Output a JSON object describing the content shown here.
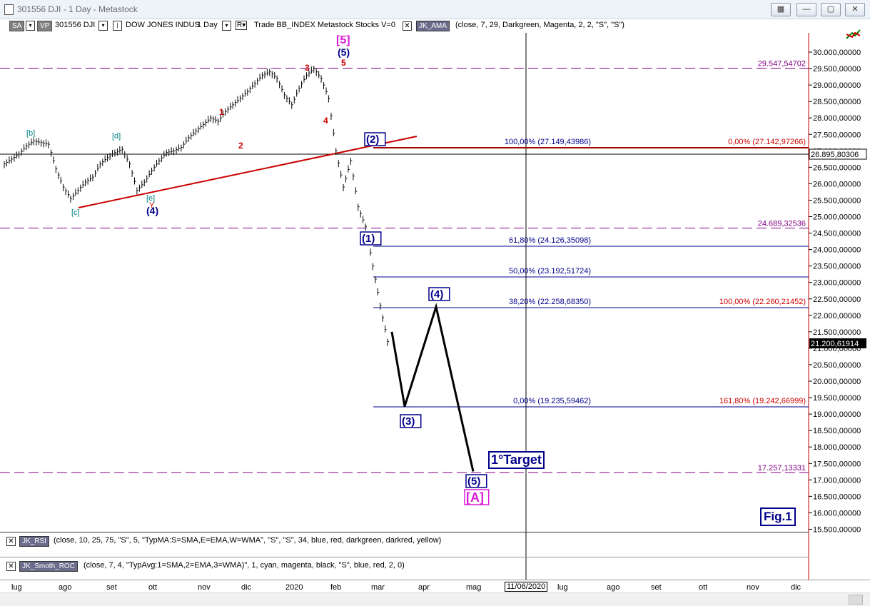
{
  "window": {
    "title": "301556 DJI - 1 Day - Metastock",
    "btn_a": "▦",
    "btn_min": "—",
    "btn_max": "▢",
    "btn_close": "✕"
  },
  "toolbar": {
    "sa": "SA",
    "vp": "VP",
    "symbol": "301556 DJI",
    "name": "DOW JONES INDUS",
    "period": "1 Day",
    "r": "R",
    "source": "Trade  BB_INDEX  Metastock  Stocks  V=0",
    "ind": "JK_AMA",
    "ind_params": "(close,  7,  29,  Darkgreen,  Magenta,  2,  2,  \"S\",  \"S\")"
  },
  "indicator_panes": [
    {
      "name": "JK_RSI",
      "params": "(close,  10,  25,  75,  \"S\",  5,  \"TypMA:S=SMA,E=EMA,W=WMA\",  \"S\",  \"S\",  34,  blue,  red,  darkgreen,  darkred,  yellow)"
    },
    {
      "name": "JK_Smoth_ROC",
      "params": "(close,  7,  4,  \"TypAvg:1=SMA,2=EMA,3=WMA)\",  1,  cyan,  magenta,  black,  \"S\",  blue,  red,  2,  0)"
    }
  ],
  "x_axis": {
    "labels": [
      "lug",
      "ago",
      "set",
      "ott",
      "nov",
      "dic",
      "2020",
      "feb",
      "mar",
      "apr",
      "mag",
      "lug",
      "ago",
      "set",
      "ott",
      "nov",
      "dic"
    ],
    "cursor_date": "11/06/2020"
  },
  "y_axis": {
    "ticks": [
      "30.000,00000",
      "29.500,00000",
      "29.000,00000",
      "28.500,00000",
      "28.000,00000",
      "27.500,00000",
      "27.000,00000",
      "26.500,00000",
      "26.000,00000",
      "25.500,00000",
      "25.000,00000",
      "24.500,00000",
      "24.000,00000",
      "23.500,00000",
      "23.000,00000",
      "22.500,00000",
      "22.000,00000",
      "21.500,00000",
      "21.000,00000",
      "20.500,00000",
      "20.000,00000",
      "19.500,00000",
      "19.000,00000",
      "18.500,00000",
      "18.000,00000",
      "17.500,00000",
      "17.000,00000",
      "16.500,00000",
      "16.000,00000",
      "15.500,00000"
    ],
    "crosshair_value": "26.895,80306",
    "last_value": "21.200,61914"
  },
  "levels": {
    "dashed": [
      "29.547,54702",
      "24.689,32536",
      "17.257,13331"
    ],
    "fib_left": [
      "100,00% (27.149,43986)",
      "61,80% (24.126,35098)",
      "50,00% (23.192,51724)",
      "38,20% (22.258,68350)",
      "0,00% (19.235,59462)"
    ],
    "fib_right": [
      "0,00% (27.142,97266)",
      "100,00% (22.260,21452)",
      "161,80% (19.242,66999)"
    ]
  },
  "wave_labels": {
    "big5": "[5]",
    "w5_paren": "(5)",
    "w5": "5",
    "w3": "3",
    "w4": "4",
    "w1": "1",
    "w2": "2",
    "b": "[b]",
    "d": "[d]",
    "c": "[c]",
    "e": "[e]",
    "y": "Y",
    "p4_old": "(4)",
    "p2": "(2)",
    "p1": "(1)",
    "p4": "(4)",
    "p3": "(3)",
    "p5": "(5)",
    "A": "[A]"
  },
  "annotations": {
    "target": "1°Target",
    "fig": "Fig.1"
  },
  "colors": {
    "wave_blue": "#00008b",
    "wave_red": "#cc0000",
    "magenta": "#d81bd8",
    "dashed": "#800080",
    "fib_blue": "#00008b",
    "trend": "#cc0000"
  },
  "chart_data": {
    "type": "line",
    "title": "",
    "ylim": [
      15500,
      30300
    ],
    "series": [
      {
        "values": [
          26600,
          26750,
          26900,
          27150,
          27300,
          27250,
          27200,
          26450,
          25900,
          25550,
          25800,
          26050,
          26200,
          26600,
          26800,
          26950,
          27050,
          26600,
          25800,
          26050,
          26400,
          26700,
          26950,
          27000,
          27100,
          27400,
          27600,
          27800,
          28000,
          27900,
          28200,
          28400,
          28600,
          28800,
          29050,
          29300,
          29400,
          29200,
          28700,
          28400,
          28900,
          29300,
          29500,
          29200,
          28600,
          27000,
          25900,
          26700,
          25300,
          24700,
          23500,
          22300,
          21200
        ]
      },
      {
        "name": "projection",
        "values": [
          21500,
          19235,
          22260,
          17257
        ]
      }
    ]
  }
}
